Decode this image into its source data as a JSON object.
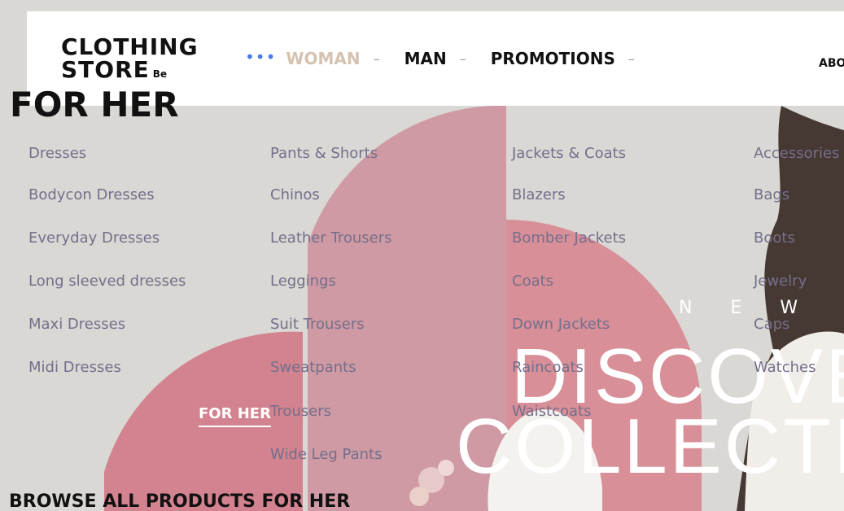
{
  "header": {
    "logo_line1": "CLOTHING",
    "logo_line2": "STORE",
    "logo_suffix": "Be",
    "nav_dots": "•••",
    "nav": [
      {
        "label": "WOMAN",
        "dash": "–"
      },
      {
        "label": "MAN",
        "dash": "–"
      },
      {
        "label": "PROMOTIONS",
        "dash": "–"
      }
    ],
    "about_label": "ABO"
  },
  "menu": {
    "title": "FOR HER",
    "columns": [
      {
        "items": [
          "Dresses",
          "Bodycon Dresses",
          "Everyday Dresses",
          "Long sleeved dresses",
          "Maxi Dresses",
          "Midi Dresses"
        ]
      },
      {
        "items": [
          "Pants & Shorts",
          "Chinos",
          "Leather Trousers",
          "Leggings",
          "Suit Trousers",
          "Sweatpants",
          "Trousers",
          "Wide Leg Pants"
        ]
      },
      {
        "items": [
          "Jackets & Coats",
          "Blazers",
          "Bomber Jackets",
          "Coats",
          "Down Jackets",
          "Raincoats",
          "Waistcoats"
        ]
      },
      {
        "items": [
          "Accessories",
          "Bags",
          "Boots",
          "Jewelry",
          "Caps",
          "Watches"
        ]
      }
    ],
    "for_her_link": "FOR HER",
    "browse_all": "BROWSE ALL PRODUCTS FOR HER"
  },
  "hero": {
    "eyebrow": "N E W",
    "title_line1": "DISCOVE",
    "title_line2": "COLLECTI"
  },
  "colors": {
    "accent": "#4b7be8",
    "active_nav": "#d5c2b0",
    "menu_text": "#746f8b",
    "arch_pink": "#d0919b"
  }
}
